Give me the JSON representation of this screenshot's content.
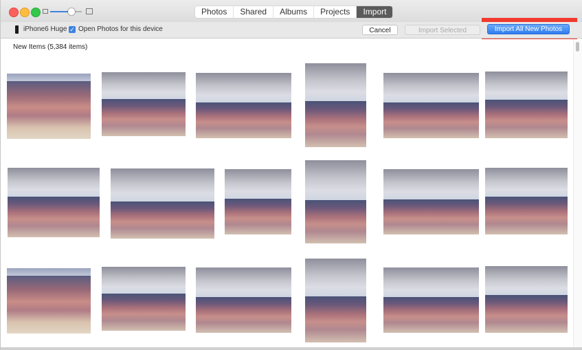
{
  "window": {
    "title_tabs": [
      {
        "label": "Photos",
        "active": false
      },
      {
        "label": "Shared",
        "active": false
      },
      {
        "label": "Albums",
        "active": false
      },
      {
        "label": "Projects",
        "active": false
      },
      {
        "label": "Import",
        "active": true
      }
    ],
    "zoom_slider_value": 0.75
  },
  "toolbar": {
    "device_name": "iPhone6 Huge",
    "open_photos_checked": true,
    "open_photos_label": "Open Photos for this device",
    "cancel_label": "Cancel",
    "import_selected_label": "Import Selected",
    "import_all_label": "Import All New Photos"
  },
  "content": {
    "section_title": "New Items (5,384 items)"
  },
  "colors": {
    "accent": "#3d83e0",
    "highlight": "#f03a2e",
    "active_tab": "#5b5b5b"
  }
}
